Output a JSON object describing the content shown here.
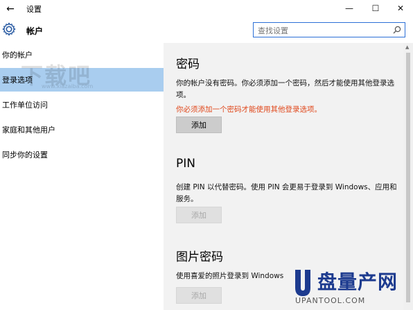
{
  "window": {
    "title": "设置",
    "back_glyph": "←",
    "minimize_glyph": "—",
    "maximize_glyph": "☐",
    "close_glyph": "✕"
  },
  "header": {
    "title": "帐户",
    "search_placeholder": "查找设置"
  },
  "sidebar": {
    "items": [
      {
        "label": "你的帐户",
        "selected": false
      },
      {
        "label": "登录选项",
        "selected": true
      },
      {
        "label": "工作单位访问",
        "selected": false
      },
      {
        "label": "家庭和其他用户",
        "selected": false
      },
      {
        "label": "同步你的设置",
        "selected": false
      }
    ],
    "watermark": "下载吧",
    "watermark_url": "www.xiazaiba.com"
  },
  "sections": {
    "password": {
      "title": "密码",
      "text": "你的帐户没有密码。你必须添加一个密码，然后才能使用其他登录选项。",
      "warning": "你必须添加一个密码才能使用其他登录选项。",
      "button": "添加"
    },
    "pin": {
      "title": "PIN",
      "text": "创建 PIN 以代替密码。使用 PIN 会更易于登录到 Windows、应用和服务。",
      "button": "添加"
    },
    "picture": {
      "title": "图片密码",
      "text": "使用喜爱的照片登录到 Windows",
      "button": "添加"
    }
  },
  "logo": {
    "text": "盘量产网",
    "url": "UPANTOOL.COM"
  },
  "colors": {
    "accent": "#2b6fd6",
    "selected_bg": "#a9cdef",
    "warning": "#e0471b",
    "content_bg": "#f2f2f2"
  }
}
